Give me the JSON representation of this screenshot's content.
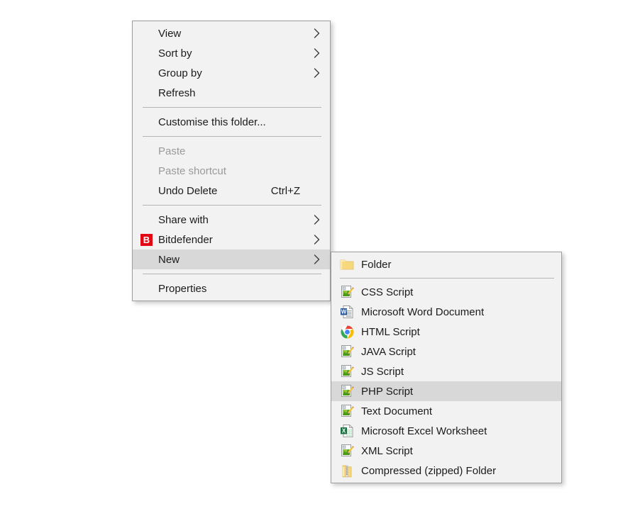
{
  "context_menu": {
    "name": "folder-background-context-menu",
    "items": [
      {
        "id": "view",
        "label": "View",
        "type": "submenu",
        "icon": null,
        "accel": null,
        "disabled": false,
        "highlighted": false
      },
      {
        "id": "sort-by",
        "label": "Sort by",
        "type": "submenu",
        "icon": null,
        "accel": null,
        "disabled": false,
        "highlighted": false
      },
      {
        "id": "group-by",
        "label": "Group by",
        "type": "submenu",
        "icon": null,
        "accel": null,
        "disabled": false,
        "highlighted": false
      },
      {
        "id": "refresh",
        "label": "Refresh",
        "type": "command",
        "icon": null,
        "accel": null,
        "disabled": false,
        "highlighted": false
      },
      {
        "id": "sep-1",
        "label": "",
        "type": "separator",
        "icon": null,
        "accel": null,
        "disabled": false,
        "highlighted": false
      },
      {
        "id": "customise",
        "label": "Customise this folder...",
        "type": "command",
        "icon": null,
        "accel": null,
        "disabled": false,
        "highlighted": false
      },
      {
        "id": "sep-2",
        "label": "",
        "type": "separator",
        "icon": null,
        "accel": null,
        "disabled": false,
        "highlighted": false
      },
      {
        "id": "paste",
        "label": "Paste",
        "type": "command",
        "icon": null,
        "accel": null,
        "disabled": true,
        "highlighted": false
      },
      {
        "id": "paste-shortcut",
        "label": "Paste shortcut",
        "type": "command",
        "icon": null,
        "accel": null,
        "disabled": true,
        "highlighted": false
      },
      {
        "id": "undo-delete",
        "label": "Undo Delete",
        "type": "command",
        "icon": null,
        "accel": "Ctrl+Z",
        "disabled": false,
        "highlighted": false
      },
      {
        "id": "sep-3",
        "label": "",
        "type": "separator",
        "icon": null,
        "accel": null,
        "disabled": false,
        "highlighted": false
      },
      {
        "id": "share-with",
        "label": "Share with",
        "type": "submenu",
        "icon": null,
        "accel": null,
        "disabled": false,
        "highlighted": false
      },
      {
        "id": "bitdefender",
        "label": "Bitdefender",
        "type": "submenu",
        "icon": "bitdefender-icon",
        "accel": null,
        "disabled": false,
        "highlighted": false
      },
      {
        "id": "new",
        "label": "New",
        "type": "submenu",
        "icon": null,
        "accel": null,
        "disabled": false,
        "highlighted": true
      },
      {
        "id": "sep-4",
        "label": "",
        "type": "separator",
        "icon": null,
        "accel": null,
        "disabled": false,
        "highlighted": false
      },
      {
        "id": "properties",
        "label": "Properties",
        "type": "command",
        "icon": null,
        "accel": null,
        "disabled": false,
        "highlighted": false
      }
    ]
  },
  "new_submenu": {
    "name": "new-submenu",
    "parent_item": "New",
    "items": [
      {
        "id": "folder",
        "label": "Folder",
        "type": "command",
        "icon": "folder-icon",
        "highlighted": false
      },
      {
        "id": "sep-1",
        "label": "",
        "type": "separator",
        "icon": null,
        "highlighted": false
      },
      {
        "id": "css-script",
        "label": "CSS Script",
        "type": "command",
        "icon": "script-file-icon",
        "highlighted": false
      },
      {
        "id": "word-document",
        "label": "Microsoft Word Document",
        "type": "command",
        "icon": "word-doc-icon",
        "highlighted": false
      },
      {
        "id": "html-script",
        "label": "HTML Script",
        "type": "command",
        "icon": "chrome-icon",
        "highlighted": false
      },
      {
        "id": "java-script",
        "label": "JAVA Script",
        "type": "command",
        "icon": "script-file-icon",
        "highlighted": false
      },
      {
        "id": "js-script",
        "label": "JS Script",
        "type": "command",
        "icon": "script-file-icon",
        "highlighted": false
      },
      {
        "id": "php-script",
        "label": "PHP Script",
        "type": "command",
        "icon": "script-file-icon",
        "highlighted": true
      },
      {
        "id": "text-document",
        "label": "Text Document",
        "type": "command",
        "icon": "script-file-icon",
        "highlighted": false
      },
      {
        "id": "excel-worksheet",
        "label": "Microsoft Excel Worksheet",
        "type": "command",
        "icon": "excel-sheet-icon",
        "highlighted": false
      },
      {
        "id": "xml-script",
        "label": "XML Script",
        "type": "command",
        "icon": "script-file-icon",
        "highlighted": false
      },
      {
        "id": "zipped-folder",
        "label": "Compressed (zipped) Folder",
        "type": "command",
        "icon": "zipped-folder-icon",
        "highlighted": false
      }
    ]
  },
  "colors": {
    "menu_background": "#f2f2f2",
    "menu_border": "#9e9e9e",
    "highlight": "#d8d8d8",
    "text": "#1b1b1b",
    "text_disabled": "#9a9a9a",
    "separator": "#b5b5b5",
    "bitdefender_red": "#e30613",
    "chrome_blue": "#4285f4",
    "word_blue": "#2b5797",
    "excel_green": "#1e7145",
    "folder_yellow": "#f6d37a",
    "page_background": "#ffffff"
  }
}
